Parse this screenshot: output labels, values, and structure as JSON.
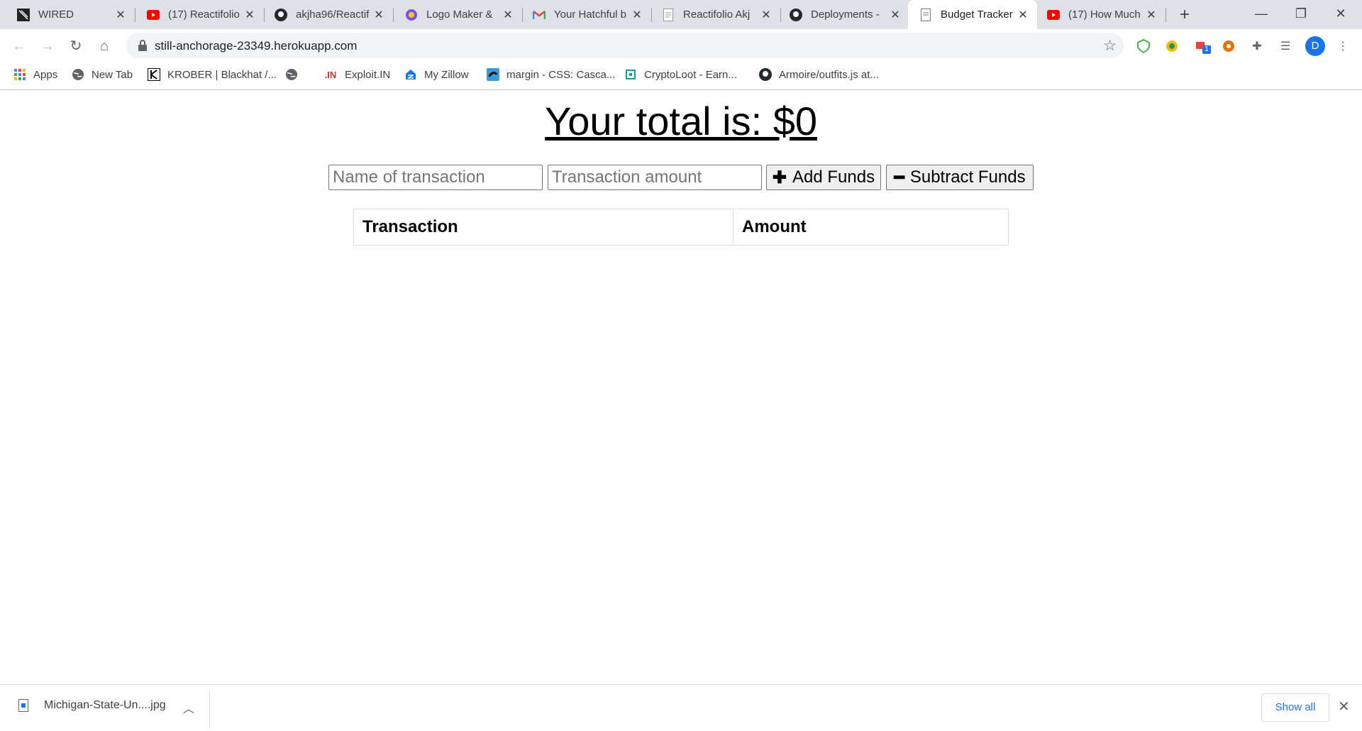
{
  "browser": {
    "tabs": [
      {
        "title": "WIRED",
        "icon": "wired-icon",
        "left": 0
      },
      {
        "title": "(17) Reactifolio",
        "icon": "youtube-icon"
      },
      {
        "title": "akjha96/Reactif",
        "icon": "github-icon"
      },
      {
        "title": "Logo Maker &",
        "icon": "logo-maker-icon"
      },
      {
        "title": "Your Hatchful b",
        "icon": "gmail-icon"
      },
      {
        "title": "Reactifolio Akj",
        "icon": "document-icon"
      },
      {
        "title": "Deployments -",
        "icon": "github-icon"
      },
      {
        "title": "Budget Tracker",
        "icon": "document-icon"
      },
      {
        "title": "(17) How Much",
        "icon": "youtube-icon"
      }
    ],
    "url": "still-anchorage-23349.herokuapp.com",
    "avatar_letter": "D",
    "extension_badge": "1",
    "bookmarks": [
      {
        "label": "Apps",
        "icon": "apps-grid-icon"
      },
      {
        "label": "New Tab",
        "icon": "globe-icon"
      },
      {
        "label": "KROBER | Blackhat /...",
        "icon": "k-logo-icon"
      },
      {
        "label": "",
        "icon": "globe-icon"
      },
      {
        "label": "Exploit.IN",
        "icon": "exploit-in-icon"
      },
      {
        "label": "My Zillow",
        "icon": "zillow-icon"
      },
      {
        "label": "margin - CSS: Casca...",
        "icon": "stackoverflow-icon"
      },
      {
        "label": "CryptoLoot - Earn...",
        "icon": "cryptoloot-icon"
      },
      {
        "label": "Armoire/outfits.js at...",
        "icon": "github-icon"
      }
    ]
  },
  "app": {
    "total_label": "Your total is: $0",
    "name_placeholder": "Name of transaction",
    "amount_placeholder": "Transaction amount",
    "add_button": "Add Funds",
    "subtract_button": "Subtract Funds",
    "table_headers": [
      "Transaction",
      "Amount"
    ]
  },
  "downloads": {
    "file_name": "Michigan-State-Un....jpg",
    "show_all": "Show all"
  }
}
